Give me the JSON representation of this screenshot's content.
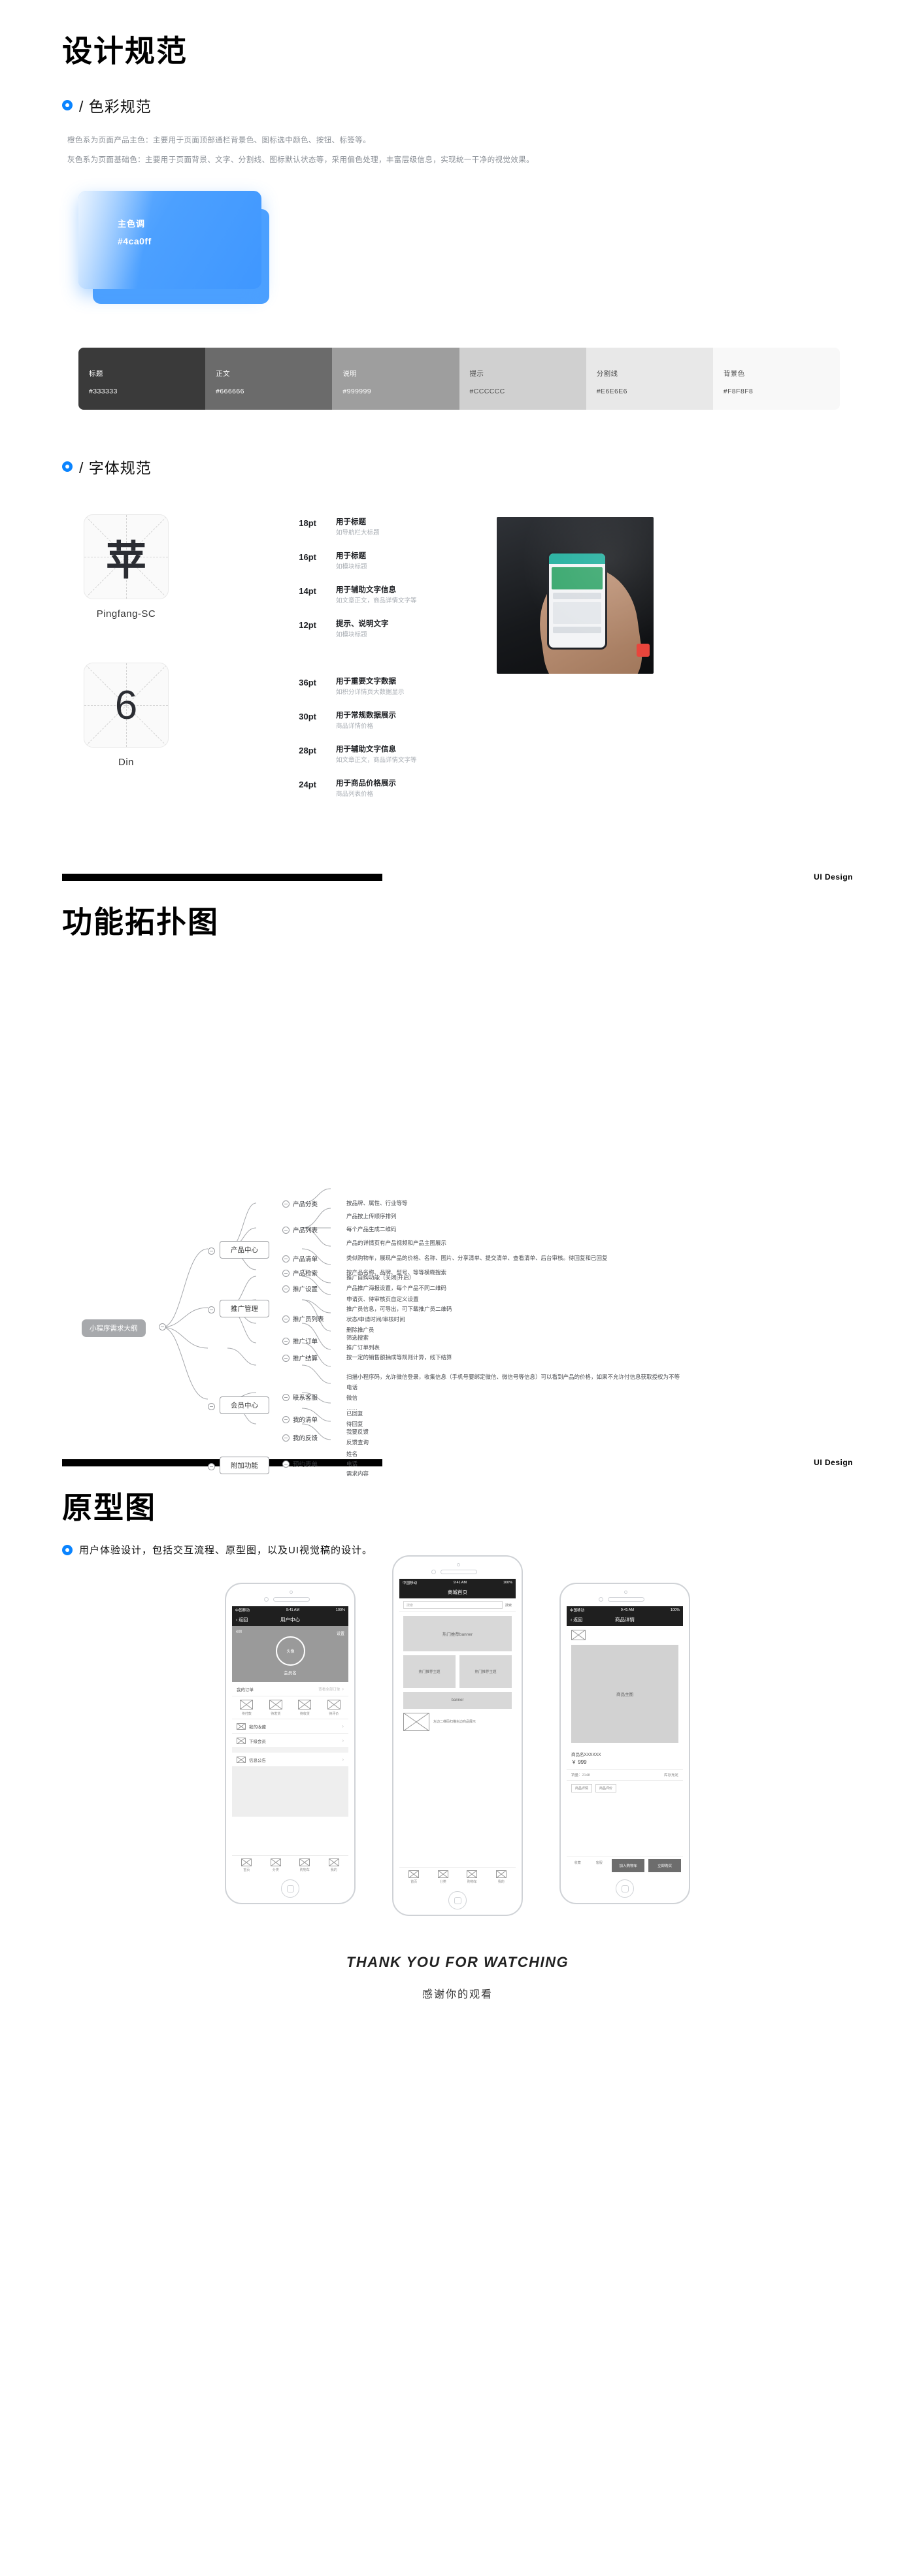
{
  "sections": {
    "design_spec": {
      "title": "设计规范",
      "color_head": "/ 色彩规范",
      "desc1": "橙色系为页面产品主色：主要用于页面顶部通栏背景色、图标选中颜色、按钮、标签等。",
      "desc2": "灰色系为页面基础色：主要用于页面背景、文字、分割线、图标默认状态等，采用偏色处理，丰富层级信息，实现统一干净的视觉效果。",
      "main_color": {
        "label": "主色调",
        "hex": "#4ca0ff"
      },
      "swatches": [
        {
          "name": "标题",
          "hex": "#333333",
          "bg": "#3a3a3a",
          "fg": "#ffffff"
        },
        {
          "name": "正文",
          "hex": "#666666",
          "bg": "#6b6b6b",
          "fg": "#ffffff"
        },
        {
          "name": "说明",
          "hex": "#999999",
          "bg": "#9e9e9e",
          "fg": "#ffffff"
        },
        {
          "name": "提示",
          "hex": "#CCCCCC",
          "bg": "#d0d0d0",
          "fg": "#4a4a4a"
        },
        {
          "name": "分割线",
          "hex": "#E6E6E6",
          "bg": "#e8e8e8",
          "fg": "#4a4a4a"
        },
        {
          "name": "背景色",
          "hex": "#F8F8F8",
          "bg": "#f8f8f8",
          "fg": "#4a4a4a"
        }
      ]
    },
    "typography": {
      "head": "/ 字体规范",
      "fonts": [
        {
          "glyph": "苹",
          "name": "Pingfang-SC"
        },
        {
          "glyph": "6",
          "name": "Din"
        }
      ],
      "sizes_cn": [
        {
          "pt": "18pt",
          "main": "用于标题",
          "sub": "如导航栏大标题"
        },
        {
          "pt": "16pt",
          "main": "用于标题",
          "sub": "如模块标题"
        },
        {
          "pt": "14pt",
          "main": "用于辅助文字信息",
          "sub": "如文章正文，商品详情文字等"
        },
        {
          "pt": "12pt",
          "main": "提示、说明文字",
          "sub": "如模块标题"
        }
      ],
      "sizes_din": [
        {
          "pt": "36pt",
          "main": "用于重要文字数据",
          "sub": "如积分详情页大数据显示"
        },
        {
          "pt": "30pt",
          "main": "用于常规数据展示",
          "sub": "商品详情价格"
        },
        {
          "pt": "28pt",
          "main": "用于辅助文字信息",
          "sub": "如文章正文，商品详情文字等"
        },
        {
          "pt": "24pt",
          "main": "用于商品价格展示",
          "sub": "商品列表价格"
        }
      ]
    },
    "topology": {
      "badge": "UI Design",
      "title": "功能拓扑图",
      "root": "小程序需求大纲",
      "branches": [
        {
          "name": "产品中心",
          "items": [
            {
              "label": "产品分类",
              "details": [
                "按品牌、属性、行业等等"
              ]
            },
            {
              "label": "产品列表",
              "details": [
                "产品按上传顺序排列",
                "每个产品生成二维码",
                "产品的详情页有产品视频和产品主图展示"
              ]
            },
            {
              "label": "产品清单",
              "details": [
                "类似购物车，展现产品的价格、名称、图片、分享清单、提交清单、查看清单、后台审核。待回复和已回复"
              ]
            },
            {
              "label": "产品检索",
              "details": [
                "按产品名称、品牌、型号、等等模糊搜索"
              ]
            }
          ]
        },
        {
          "name": "推广管理",
          "items": [
            {
              "label": "推广设置",
              "details": [
                "推广自购功能（关闭|开启）",
                "产品推广海报设置，每个产品不同二维码",
                "申请页、待审核页自定义设置"
              ]
            },
            {
              "label": "推广员列表",
              "details": [
                "推广员信息，可导出，可下载推广员二维码",
                "状态/申请时间/审核时间",
                "删除推广员"
              ]
            },
            {
              "label": "推广订单",
              "details": [
                "筛选搜索",
                "推广订单列表"
              ]
            },
            {
              "label": "推广结算",
              "details": [
                "按一定的销售额抽成等规则计算，线下结算"
              ]
            }
          ]
        },
        {
          "name": "会员中心",
          "items": [
            {
              "label": "",
              "details": [
                "扫描小程序码，允许微信登录，收集信息（手机号要绑定微信、微信号等信息）可以看到产品的价格，如果不允许付信息获取授权为不等"
              ]
            },
            {
              "label": "联系客服",
              "details": [
                "电话",
                "微信",
                "……"
              ]
            },
            {
              "label": "我的清单",
              "details": [
                "已回复",
                "待回复"
              ]
            },
            {
              "label": "我的反馈",
              "details": [
                "我要反馈",
                "反馈查询"
              ]
            }
          ]
        },
        {
          "name": "附加功能",
          "items": [
            {
              "label": "预约表单",
              "details": [
                "姓名",
                "电话",
                "需求内容"
              ]
            }
          ]
        }
      ]
    },
    "prototype": {
      "badge": "UI Design",
      "title": "原型图",
      "desc": "用户体验设计，包括交互流程、原型图，以及UI视觉稿的设计。",
      "phones": [
        {
          "status": {
            "carrier": "中国移动",
            "time": "9:41 AM",
            "battery": "100%"
          },
          "nav": {
            "back": "返回",
            "title": "用户中心"
          },
          "hero": {
            "settings": "设置",
            "avatar": "头像",
            "name": "会员名",
            "corner": "返回"
          },
          "order_row": {
            "label": "我的订单",
            "right": "查看全部订单"
          },
          "quad": [
            "待付款",
            "待发货",
            "待收货",
            "待评价"
          ],
          "list": [
            "我的收藏",
            "下级会员",
            "信息公告"
          ],
          "tabbar": [
            "首页",
            "分类",
            "购物车",
            "我的"
          ]
        },
        {
          "status": {
            "carrier": "中国移动",
            "time": "9:41 AM",
            "battery": "100%"
          },
          "nav": {
            "title": "商城首页"
          },
          "search_placeholder": "搜索",
          "search_button": "搜索",
          "banner_top": "热门推荐banner",
          "grid": [
            "热门推荐主题",
            "热门推荐主题"
          ],
          "banner_mid": "banner",
          "note": "左边二维码扫描右边商品展示"
        },
        {
          "status": {
            "carrier": "中国移动",
            "time": "9:41 AM",
            "battery": "100%"
          },
          "nav": {
            "back": "返回",
            "title": "商品详情"
          },
          "main_image": "商品主图",
          "goods_title": "商品名XXXXXX",
          "price": "￥ 999",
          "sub_info": [
            "销量：2148",
            "库存充足"
          ],
          "tags": [
            "商品详情",
            "商品评价"
          ],
          "bottom": {
            "icons": [
              "收藏",
              "客服"
            ],
            "buttons": [
              "加入购物车",
              "立即购买"
            ]
          }
        }
      ]
    },
    "footer": {
      "en": "THANK YOU FOR WATCHING",
      "cn": "感谢你的观看"
    }
  }
}
